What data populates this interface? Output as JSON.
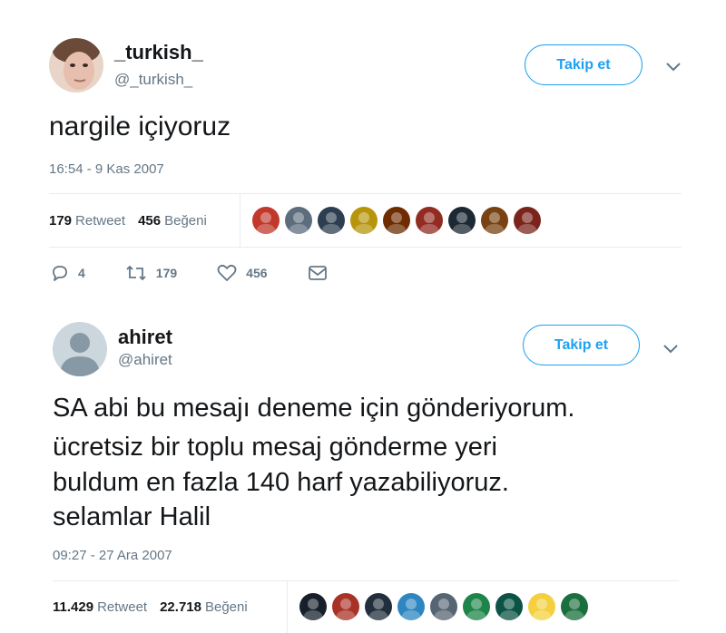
{
  "tweets": [
    {
      "name": "_turkish_",
      "handle": "@_turkish_",
      "follow_label": "Takip et",
      "text_lines": [
        "nargile içiyoruz"
      ],
      "timestamp": "16:54 - 9 Kas 2007",
      "retweet_count": "179",
      "retweet_label": "Retweet",
      "like_count": "456",
      "like_label": "Beğeni",
      "reply_count": "4",
      "action_retweet_count": "179",
      "action_like_count": "456",
      "liker_colors": [
        "#c0392b",
        "#5d6d7e",
        "#2c3e50",
        "#b7950b",
        "#6e2c00",
        "#922b21",
        "#1c2833",
        "#784212",
        "#7b241c"
      ]
    },
    {
      "name": "ahiret",
      "handle": "@ahiret",
      "follow_label": "Takip et",
      "text_lines": [
        "SA abi bu mesajı deneme için gönderiyorum.",
        "ücretsiz bir toplu mesaj gönderme yeri",
        "buldum en fazla 140 harf yazabiliyoruz.",
        "selamlar Halil"
      ],
      "timestamp": "09:27 - 27 Ara 2007",
      "retweet_count": "11.429",
      "retweet_label": "Retweet",
      "like_count": "22.718",
      "like_label": "Beğeni",
      "liker_colors": [
        "#17202a",
        "#a93226",
        "#212f3d",
        "#2e86c1",
        "#566573",
        "#1e8449",
        "#0b5345",
        "#f4d03f",
        "#196f3d"
      ]
    }
  ],
  "colors": {
    "accent": "#1da1f2",
    "secondary_text": "#657786",
    "primary_text": "#14171a",
    "divider": "#e6ecf0"
  },
  "icons": {
    "reply": "reply-icon",
    "retweet": "retweet-icon",
    "like": "heart-icon",
    "dm": "envelope-icon",
    "more": "chevron-down-icon"
  }
}
